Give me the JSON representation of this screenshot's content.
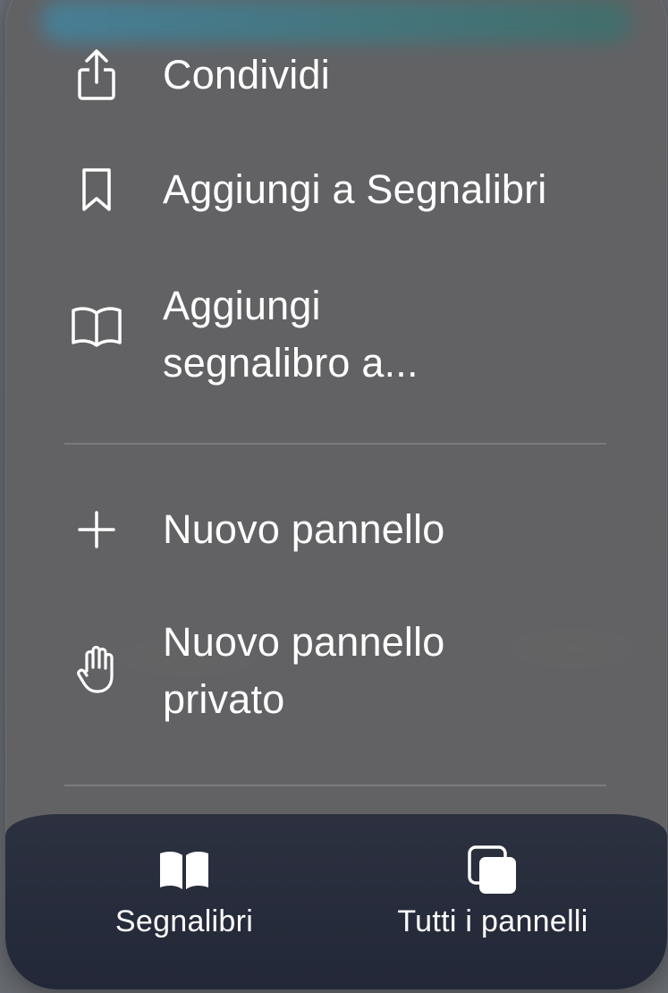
{
  "menu": {
    "items": [
      {
        "label": "Condividi",
        "icon": "share-icon"
      },
      {
        "label": "Aggiungi a Segnalibri",
        "icon": "bookmark-icon"
      },
      {
        "label_line1": "Aggiungi",
        "label_line2": "segnalibro a...",
        "icon": "open-book-icon"
      },
      {
        "label": "Nuovo pannello",
        "icon": "plus-icon"
      },
      {
        "label_line1": "Nuovo pannello",
        "label_line2": "privato",
        "icon": "hand-icon"
      }
    ]
  },
  "bottom_bar": {
    "bookmarks_label": "Segnalibri",
    "all_tabs_label": "Tutti i pannelli"
  },
  "colors": {
    "menu_background": "#626264",
    "bottom_bar_background": "#272c3b",
    "text": "#ffffff"
  }
}
